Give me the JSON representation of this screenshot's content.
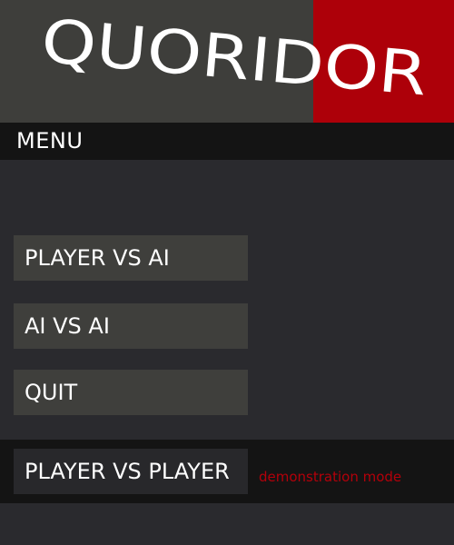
{
  "title": {
    "text": "QUORIDOR",
    "colors": {
      "left_panel": "#3e3e3b",
      "right_panel": "#ad0009",
      "text": "#ffffff"
    }
  },
  "menu": {
    "label": "MENU"
  },
  "buttons": {
    "player_vs_ai": "PLAYER VS AI",
    "ai_vs_ai": "AI VS AI",
    "quit": "QUIT"
  },
  "demo": {
    "player_vs_player": "PLAYER VS PLAYER",
    "note": "demonstration mode",
    "note_color": "#b3000a"
  }
}
